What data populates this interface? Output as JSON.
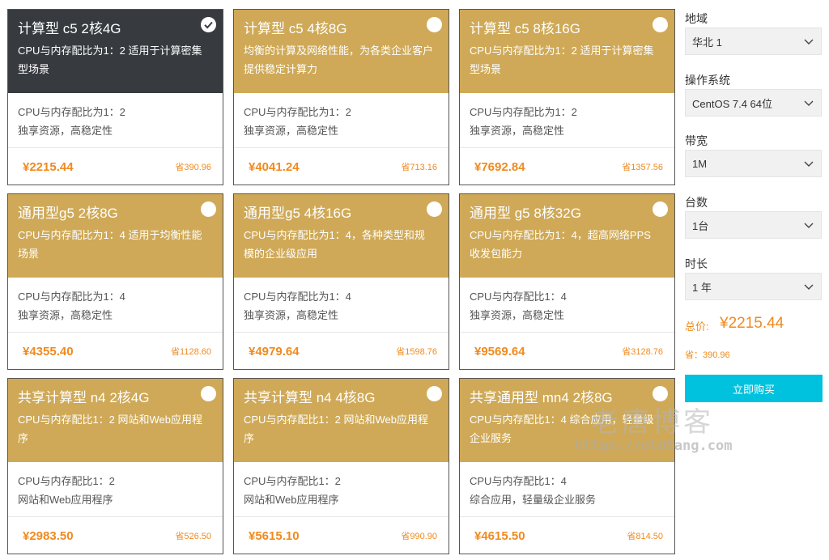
{
  "cards": [
    {
      "title": "计算型 c5 2核4G",
      "desc": "CPU与内存配比为1：2 适用于计算密集型场景",
      "spec1": "CPU与内存配比为1：2",
      "spec2": "独享资源，高稳定性",
      "price": "¥2215.44",
      "save": "省390.96",
      "selected": true
    },
    {
      "title": "计算型 c5 4核8G",
      "desc": "均衡的计算及网络性能，为各类企业客户提供稳定计算力",
      "spec1": "CPU与内存配比为1：2",
      "spec2": "独享资源，高稳定性",
      "price": "¥4041.24",
      "save": "省713.16",
      "selected": false
    },
    {
      "title": "计算型 c5 8核16G",
      "desc": "CPU与内存配比为1：2 适用于计算密集型场景",
      "spec1": "CPU与内存配比为1：2",
      "spec2": "独享资源，高稳定性",
      "price": "¥7692.84",
      "save": "省1357.56",
      "selected": false
    },
    {
      "title": "通用型g5 2核8G",
      "desc": "CPU与内存配比为1：4 适用于均衡性能场景",
      "spec1": "CPU与内存配比为1：4",
      "spec2": "独享资源，高稳定性",
      "price": "¥4355.40",
      "save": "省1128.60",
      "selected": false
    },
    {
      "title": "通用型g5 4核16G",
      "desc": "CPU与内存配比为1：4，各种类型和规模的企业级应用",
      "spec1": "CPU与内存配比为1：4",
      "spec2": "独享资源，高稳定性",
      "price": "¥4979.64",
      "save": "省1598.76",
      "selected": false
    },
    {
      "title": "通用型 g5 8核32G",
      "desc": "CPU与内存配比为1：4，超高网络PPS收发包能力",
      "spec1": "CPU与内存配比1：4",
      "spec2": "独享资源，高稳定性",
      "price": "¥9569.64",
      "save": "省3128.76",
      "selected": false
    },
    {
      "title": "共享计算型 n4 2核4G",
      "desc": "CPU与内存配比1：2 网站和Web应用程序",
      "spec1": "CPU与内存配比1：2",
      "spec2": "网站和Web应用程序",
      "price": "¥2983.50",
      "save": "省526.50",
      "selected": false
    },
    {
      "title": "共享计算型 n4 4核8G",
      "desc": "CPU与内存配比1：2 网站和Web应用程序",
      "spec1": "CPU与内存配比1：2",
      "spec2": "网站和Web应用程序",
      "price": "¥5615.10",
      "save": "省990.90",
      "selected": false
    },
    {
      "title": "共享通用型 mn4 2核8G",
      "desc": "CPU与内存配比1：4 综合应用，轻量级企业服务",
      "spec1": "CPU与内存配比1：4",
      "spec2": "综合应用，轻量级企业服务",
      "price": "¥4615.50",
      "save": "省814.50",
      "selected": false
    }
  ],
  "sidebar": {
    "fields": [
      {
        "label": "地域",
        "value": "华北 1"
      },
      {
        "label": "操作系统",
        "value": "CentOS 7.4 64位"
      },
      {
        "label": "带宽",
        "value": "1M"
      },
      {
        "label": "台数",
        "value": "1台"
      },
      {
        "label": "时长",
        "value": "1 年"
      }
    ],
    "total_label": "总价:",
    "total_value": "¥2215.44",
    "total_save": "省：390.96",
    "buy_label": "立即购买"
  },
  "watermark": {
    "cn": "老唐博客",
    "url": "https://oldtang.com"
  },
  "colors": {
    "card_gold": "#cfa957",
    "card_selected": "#373b40",
    "price_orange": "#f08a1f",
    "buy_button": "#00c1de"
  },
  "icons": {
    "radio_checked": "check-circle-icon",
    "radio_unchecked": "circle-icon",
    "select": "chevron-down-icon"
  }
}
